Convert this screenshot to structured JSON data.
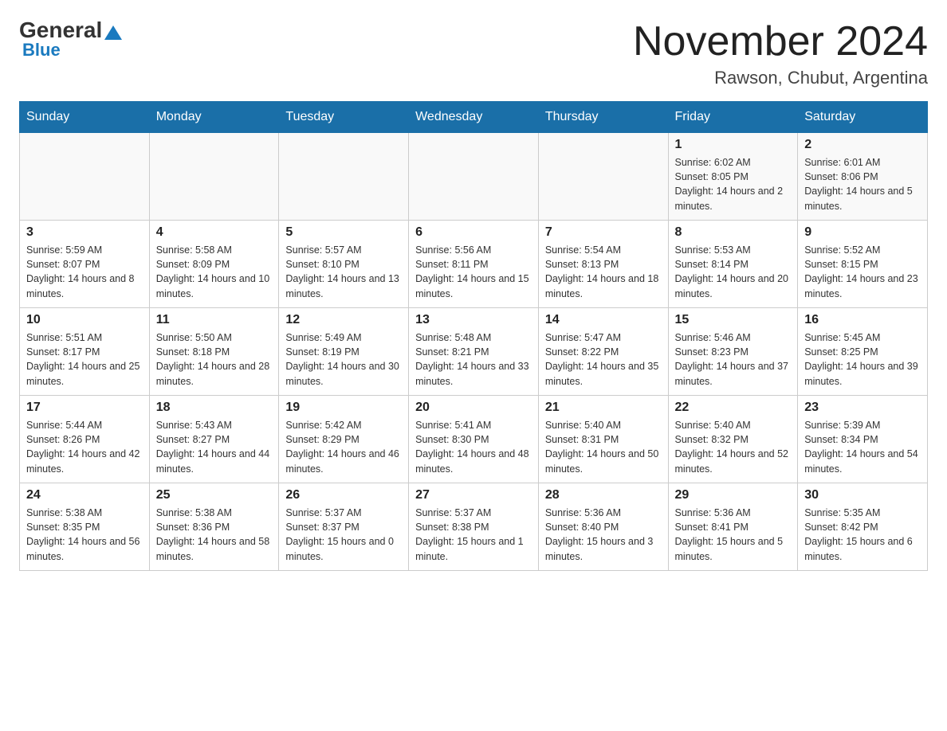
{
  "header": {
    "logo_general": "General",
    "logo_blue": "Blue",
    "month_title": "November 2024",
    "location": "Rawson, Chubut, Argentina"
  },
  "days_of_week": [
    "Sunday",
    "Monday",
    "Tuesday",
    "Wednesday",
    "Thursday",
    "Friday",
    "Saturday"
  ],
  "weeks": [
    {
      "days": [
        {
          "num": "",
          "info": ""
        },
        {
          "num": "",
          "info": ""
        },
        {
          "num": "",
          "info": ""
        },
        {
          "num": "",
          "info": ""
        },
        {
          "num": "",
          "info": ""
        },
        {
          "num": "1",
          "info": "Sunrise: 6:02 AM\nSunset: 8:05 PM\nDaylight: 14 hours and 2 minutes."
        },
        {
          "num": "2",
          "info": "Sunrise: 6:01 AM\nSunset: 8:06 PM\nDaylight: 14 hours and 5 minutes."
        }
      ]
    },
    {
      "days": [
        {
          "num": "3",
          "info": "Sunrise: 5:59 AM\nSunset: 8:07 PM\nDaylight: 14 hours and 8 minutes."
        },
        {
          "num": "4",
          "info": "Sunrise: 5:58 AM\nSunset: 8:09 PM\nDaylight: 14 hours and 10 minutes."
        },
        {
          "num": "5",
          "info": "Sunrise: 5:57 AM\nSunset: 8:10 PM\nDaylight: 14 hours and 13 minutes."
        },
        {
          "num": "6",
          "info": "Sunrise: 5:56 AM\nSunset: 8:11 PM\nDaylight: 14 hours and 15 minutes."
        },
        {
          "num": "7",
          "info": "Sunrise: 5:54 AM\nSunset: 8:13 PM\nDaylight: 14 hours and 18 minutes."
        },
        {
          "num": "8",
          "info": "Sunrise: 5:53 AM\nSunset: 8:14 PM\nDaylight: 14 hours and 20 minutes."
        },
        {
          "num": "9",
          "info": "Sunrise: 5:52 AM\nSunset: 8:15 PM\nDaylight: 14 hours and 23 minutes."
        }
      ]
    },
    {
      "days": [
        {
          "num": "10",
          "info": "Sunrise: 5:51 AM\nSunset: 8:17 PM\nDaylight: 14 hours and 25 minutes."
        },
        {
          "num": "11",
          "info": "Sunrise: 5:50 AM\nSunset: 8:18 PM\nDaylight: 14 hours and 28 minutes."
        },
        {
          "num": "12",
          "info": "Sunrise: 5:49 AM\nSunset: 8:19 PM\nDaylight: 14 hours and 30 minutes."
        },
        {
          "num": "13",
          "info": "Sunrise: 5:48 AM\nSunset: 8:21 PM\nDaylight: 14 hours and 33 minutes."
        },
        {
          "num": "14",
          "info": "Sunrise: 5:47 AM\nSunset: 8:22 PM\nDaylight: 14 hours and 35 minutes."
        },
        {
          "num": "15",
          "info": "Sunrise: 5:46 AM\nSunset: 8:23 PM\nDaylight: 14 hours and 37 minutes."
        },
        {
          "num": "16",
          "info": "Sunrise: 5:45 AM\nSunset: 8:25 PM\nDaylight: 14 hours and 39 minutes."
        }
      ]
    },
    {
      "days": [
        {
          "num": "17",
          "info": "Sunrise: 5:44 AM\nSunset: 8:26 PM\nDaylight: 14 hours and 42 minutes."
        },
        {
          "num": "18",
          "info": "Sunrise: 5:43 AM\nSunset: 8:27 PM\nDaylight: 14 hours and 44 minutes."
        },
        {
          "num": "19",
          "info": "Sunrise: 5:42 AM\nSunset: 8:29 PM\nDaylight: 14 hours and 46 minutes."
        },
        {
          "num": "20",
          "info": "Sunrise: 5:41 AM\nSunset: 8:30 PM\nDaylight: 14 hours and 48 minutes."
        },
        {
          "num": "21",
          "info": "Sunrise: 5:40 AM\nSunset: 8:31 PM\nDaylight: 14 hours and 50 minutes."
        },
        {
          "num": "22",
          "info": "Sunrise: 5:40 AM\nSunset: 8:32 PM\nDaylight: 14 hours and 52 minutes."
        },
        {
          "num": "23",
          "info": "Sunrise: 5:39 AM\nSunset: 8:34 PM\nDaylight: 14 hours and 54 minutes."
        }
      ]
    },
    {
      "days": [
        {
          "num": "24",
          "info": "Sunrise: 5:38 AM\nSunset: 8:35 PM\nDaylight: 14 hours and 56 minutes."
        },
        {
          "num": "25",
          "info": "Sunrise: 5:38 AM\nSunset: 8:36 PM\nDaylight: 14 hours and 58 minutes."
        },
        {
          "num": "26",
          "info": "Sunrise: 5:37 AM\nSunset: 8:37 PM\nDaylight: 15 hours and 0 minutes."
        },
        {
          "num": "27",
          "info": "Sunrise: 5:37 AM\nSunset: 8:38 PM\nDaylight: 15 hours and 1 minute."
        },
        {
          "num": "28",
          "info": "Sunrise: 5:36 AM\nSunset: 8:40 PM\nDaylight: 15 hours and 3 minutes."
        },
        {
          "num": "29",
          "info": "Sunrise: 5:36 AM\nSunset: 8:41 PM\nDaylight: 15 hours and 5 minutes."
        },
        {
          "num": "30",
          "info": "Sunrise: 5:35 AM\nSunset: 8:42 PM\nDaylight: 15 hours and 6 minutes."
        }
      ]
    }
  ]
}
